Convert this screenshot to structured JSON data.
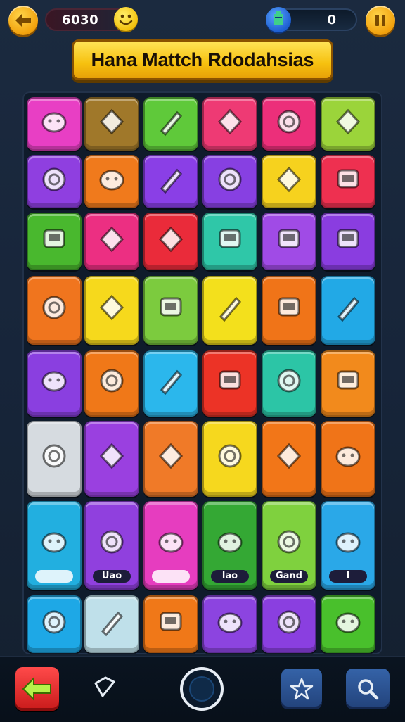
{
  "header": {
    "score": "6030",
    "coins": "0",
    "title": "Hana Mattch Rdodahsias"
  },
  "icons": {
    "back": "arrow-left-icon",
    "smiley": "smiley-face-icon",
    "coin": "blue-gem-icon",
    "pause": "pause-icon"
  },
  "board": {
    "rows": [
      [
        {
          "color": "#e83fc4",
          "icon": "sun-gear-icon"
        },
        {
          "color": "#a0782a",
          "icon": "paint-palette-icon"
        },
        {
          "color": "#5fc93a",
          "icon": "apple-face-icon"
        },
        {
          "color": "#ee3a74",
          "icon": "paper-plane-icon"
        },
        {
          "color": "#ec2f7a",
          "icon": "wrench-icon"
        },
        {
          "color": "#9bd43a",
          "icon": "character-face-icon"
        }
      ],
      [
        {
          "color": "#8f3fe0",
          "icon": "magnifier-leaf-icon"
        },
        {
          "color": "#f07a1c",
          "icon": "computer-monitor-icon"
        },
        {
          "color": "#8a3fe6",
          "icon": "bear-face-icon"
        },
        {
          "color": "#8740e2",
          "icon": "hexagon-gem-icon"
        },
        {
          "color": "#f6d21e",
          "icon": "frog-face-icon"
        },
        {
          "color": "#ee3050",
          "icon": "virus-face-icon"
        }
      ],
      [
        {
          "color": "#49b82e",
          "icon": "brush-pen-icon"
        },
        {
          "color": "#ec2f82",
          "icon": "tv-box-icon"
        },
        {
          "color": "#ea2b3a",
          "icon": "ring-donut-icon"
        },
        {
          "color": "#2fc7a8",
          "icon": "paint-brush-icon"
        },
        {
          "color": "#a04be6",
          "icon": "ghost-frog-icon"
        },
        {
          "color": "#8a3de0",
          "icon": "crossed-pencil-icon"
        }
      ],
      [
        {
          "color": "#f0751e",
          "icon": "map-pin-icon"
        },
        {
          "color": "#f6d91c",
          "icon": "green-bush-icon"
        },
        {
          "color": "#7ccb3e",
          "icon": "magnifying-glass-icon"
        },
        {
          "color": "#f3e01c",
          "icon": "pencil-icon"
        },
        {
          "color": "#f07418",
          "icon": "pink-roll-icon"
        },
        {
          "color": "#22a9e6",
          "icon": "desk-lamp-icon"
        }
      ],
      [
        {
          "color": "#8a3fe0",
          "icon": "cassette-radio-icon"
        },
        {
          "color": "#f07818",
          "icon": "green-dino-icon"
        },
        {
          "color": "#2bb7ec",
          "icon": "hammer-card-icon"
        },
        {
          "color": "#ec3326",
          "icon": "blue-ring-icon"
        },
        {
          "color": "#2cc5a6",
          "icon": "red-feather-brush-icon"
        },
        {
          "color": "#f28a1c",
          "icon": "green-rocket-icon"
        }
      ],
      [
        {
          "color": "#d6dbe0",
          "icon": "robot-icon"
        },
        {
          "color": "#9a40e0",
          "icon": "bear-cup-icon"
        },
        {
          "color": "#f07a28",
          "icon": "captain-face-icon"
        },
        {
          "color": "#f6d81e",
          "icon": "toolbox-icon"
        },
        {
          "color": "#f27618",
          "icon": "green-blob-icon"
        },
        {
          "color": "#f07418",
          "icon": "blue-jar-icon"
        }
      ],
      [
        {
          "color": "#22afe0",
          "icon": "bandage-coin-icon",
          "label": ""
        },
        {
          "color": "#9040de",
          "icon": "question-mark-icon",
          "label": "Uao"
        },
        {
          "color": "#e63dbf",
          "icon": "phone-icon",
          "label": ""
        },
        {
          "color": "#34a834",
          "icon": "arcade-cabinet-icon",
          "label": "lao"
        },
        {
          "color": "#7fd13e",
          "icon": "chest-icon",
          "label": "Gand"
        },
        {
          "color": "#2aa8e8",
          "icon": "pearl-potion-icon",
          "label": "I"
        }
      ],
      [
        {
          "color": "#1ea8e6",
          "icon": "red-ring-icon"
        },
        {
          "color": "#bfe0ea",
          "icon": "gear-ring-icon"
        },
        {
          "color": "#f07818",
          "icon": "globe-bottle-icon"
        },
        {
          "color": "#8c44e0",
          "icon": "gift-box-icon"
        },
        {
          "color": "#8a3fe0",
          "icon": "paper-bag-icon"
        },
        {
          "color": "#49c02c",
          "icon": "hammer-tool-icon"
        }
      ]
    ]
  },
  "nav": {
    "home": "arrow-left-icon",
    "diamond": "diamond-outline-icon",
    "center": "circle-button-icon",
    "star": "star-icon",
    "search": "search-icon"
  }
}
